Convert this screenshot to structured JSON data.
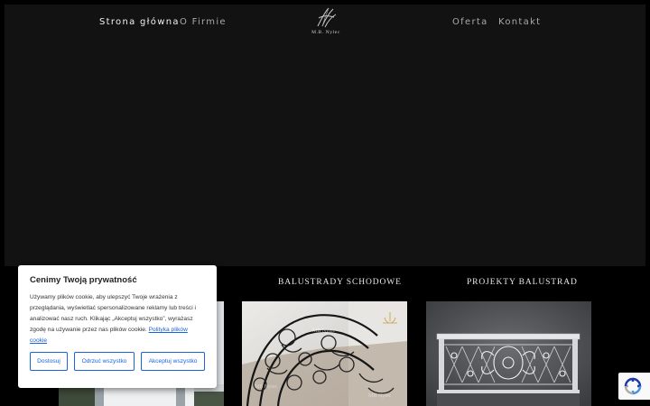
{
  "nav": {
    "home": "Strona główna",
    "about": "O Firmie",
    "offer": "Oferta",
    "contact": "Kontakt"
  },
  "logo": {
    "text": "M.B. Nylec"
  },
  "sections": {
    "stairs_title": "BALUSTRADY SCHODOWE",
    "projects_title": "PROJEKTY BALUSTRAD"
  },
  "cookie": {
    "title": "Cenimy Twoją prywatność",
    "body": "Używamy plików cookie, aby ulepszyć Twoje wrażenia z przeglądania, wyświetlać spersonalizowane reklamy lub treści i analizować nasz ruch. Klikając „Akceptuj wszystko”, wyrażasz zgodę na używanie przez nas plików cookie.",
    "policy_link": "Polityka plików cookie",
    "customize": "Dostosuj",
    "reject": "Odrzuć wszystko",
    "accept": "Akceptuj wszystko"
  },
  "images": {
    "stairs_watermark": "MB Nylec"
  },
  "colors": {
    "background": "#000000",
    "hero": "#121212",
    "accent": "#1863dc"
  },
  "icons": {
    "logo": "monogram-logo-icon",
    "recaptcha": "recaptcha-icon"
  }
}
